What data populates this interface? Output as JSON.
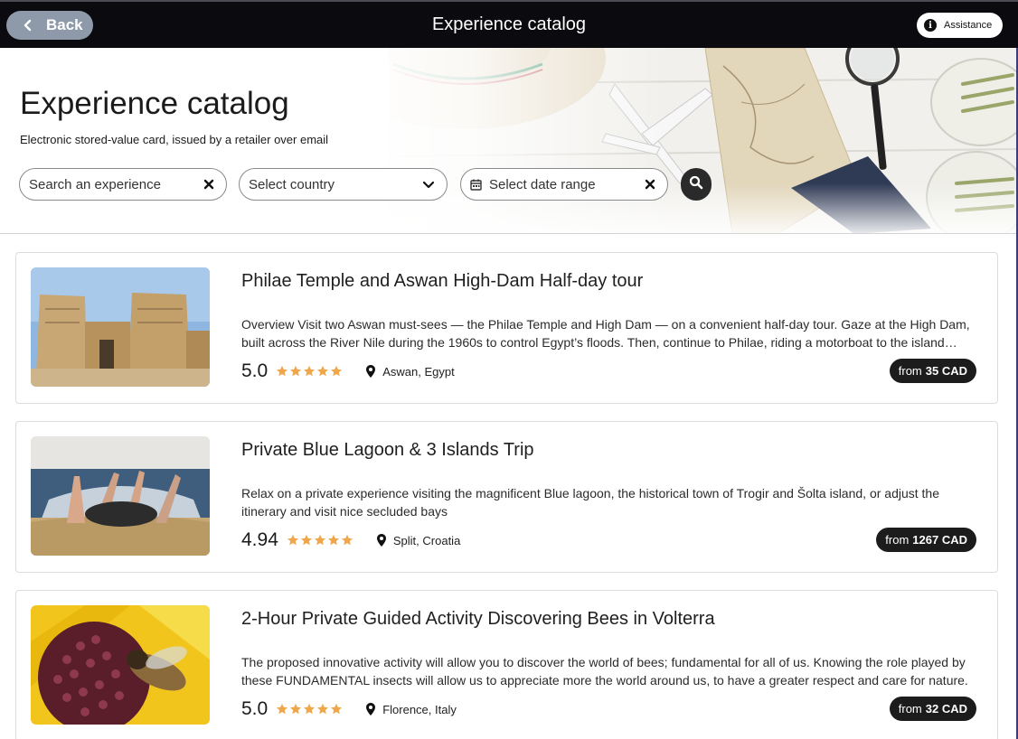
{
  "topbar": {
    "back_label": "Back",
    "title": "Experience catalog",
    "assistance_label": "Assistance"
  },
  "hero": {
    "title": "Experience catalog",
    "subtitle": "Electronic stored-value card, issued by a retailer over email"
  },
  "filters": {
    "search_placeholder": "Search an experience",
    "country_placeholder": "Select country",
    "date_placeholder": "Select date range"
  },
  "experiences": [
    {
      "title": "Philae Temple and Aswan High-Dam Half-day tour",
      "description": "Overview Visit two Aswan must-sees — the Philae Temple and High Dam — on a convenient half-day tour. Gaze at the High Dam, built across the River Nile during the 1960s to control Egypt’s floods. Then, continue to Philae, riding a motorboat to the island temple complex.",
      "rating": "5.0",
      "stars": 5,
      "location": "Aswan, Egypt",
      "price_prefix": "from",
      "price": "35 CAD"
    },
    {
      "title": "Private Blue Lagoon & 3 Islands Trip",
      "description": "Relax on a private experience visiting the magnificent Blue lagoon, the historical town of Trogir and Šolta island, or adjust the itinerary and visit nice secluded bays",
      "rating": "4.94",
      "stars": 5,
      "location": "Split, Croatia",
      "price_prefix": "from",
      "price": "1267 CAD"
    },
    {
      "title": "2-Hour Private Guided Activity Discovering Bees in Volterra",
      "description": "The proposed innovative activity will allow you to discover the world of bees; fundamental for all of us. Knowing the role played by these FUNDAMENTAL insects will allow us to appreciate more the world around us, to have a greater respect and care for nature.",
      "rating": "5.0",
      "stars": 5,
      "location": "Florence, Italy",
      "price_prefix": "from",
      "price": "32 CAD"
    }
  ],
  "colors": {
    "topbar_bg": "#0b0b0f",
    "back_button": "#8e9aaa",
    "star": "#f0a64a",
    "price_badge": "#1c1c1c"
  }
}
